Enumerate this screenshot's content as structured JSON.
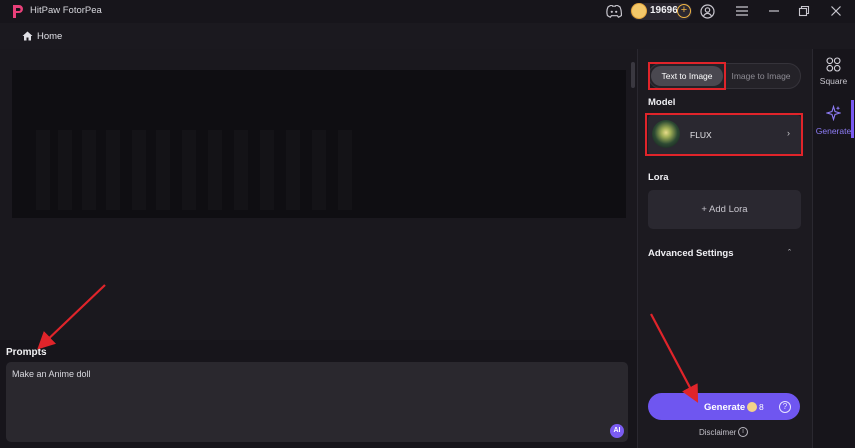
{
  "app": {
    "title": "HitPaw FotorPea",
    "coins": "19696"
  },
  "nav": {
    "home_label": "Home"
  },
  "prompts": {
    "title": "Prompts",
    "value": "Make an Anime doll",
    "ai_label": "AI"
  },
  "panel": {
    "tabs": [
      {
        "label": "Text to Image",
        "active": true
      },
      {
        "label": "Image to Image",
        "active": false
      }
    ],
    "model_title": "Model",
    "model_name": "FLUX",
    "lora_title": "Lora",
    "add_lora": "+ Add Lora",
    "advanced_title": "Advanced Settings",
    "generate_label": "Generate",
    "generate_cost": "8",
    "disclaimer": "Disclaimer"
  },
  "rail": {
    "items": [
      {
        "label": "Square",
        "icon": "grid-icon"
      },
      {
        "label": "Generate",
        "icon": "sparkle-icon",
        "active": true
      }
    ]
  },
  "colors": {
    "accent": "#6f56f0",
    "highlight": "#e0242a",
    "coin": "#f4c86a"
  }
}
